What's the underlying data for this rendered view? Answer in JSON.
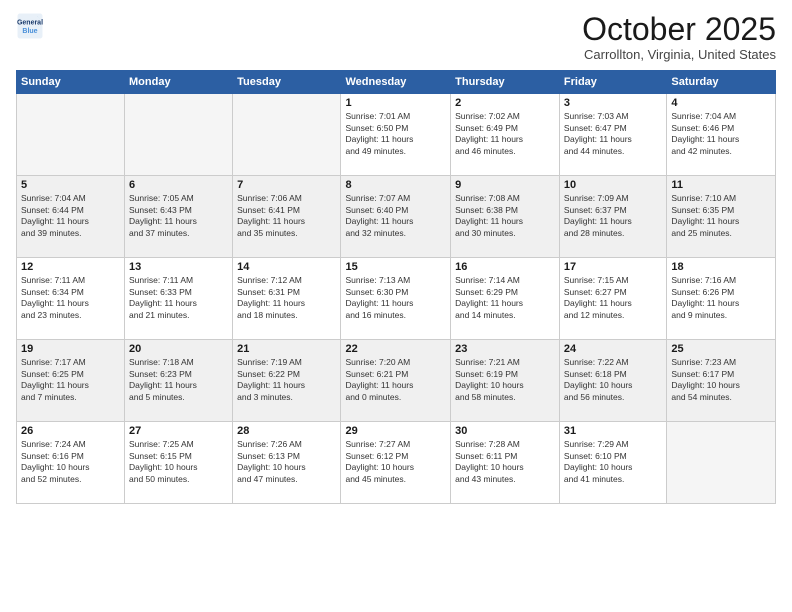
{
  "logo": {
    "line1": "General",
    "line2": "Blue"
  },
  "header": {
    "month": "October 2025",
    "location": "Carrollton, Virginia, United States"
  },
  "days_of_week": [
    "Sunday",
    "Monday",
    "Tuesday",
    "Wednesday",
    "Thursday",
    "Friday",
    "Saturday"
  ],
  "weeks": [
    {
      "bg": "white",
      "days": [
        {
          "num": "",
          "info": ""
        },
        {
          "num": "",
          "info": ""
        },
        {
          "num": "",
          "info": ""
        },
        {
          "num": "1",
          "info": "Sunrise: 7:01 AM\nSunset: 6:50 PM\nDaylight: 11 hours\nand 49 minutes."
        },
        {
          "num": "2",
          "info": "Sunrise: 7:02 AM\nSunset: 6:49 PM\nDaylight: 11 hours\nand 46 minutes."
        },
        {
          "num": "3",
          "info": "Sunrise: 7:03 AM\nSunset: 6:47 PM\nDaylight: 11 hours\nand 44 minutes."
        },
        {
          "num": "4",
          "info": "Sunrise: 7:04 AM\nSunset: 6:46 PM\nDaylight: 11 hours\nand 42 minutes."
        }
      ]
    },
    {
      "bg": "gray",
      "days": [
        {
          "num": "5",
          "info": "Sunrise: 7:04 AM\nSunset: 6:44 PM\nDaylight: 11 hours\nand 39 minutes."
        },
        {
          "num": "6",
          "info": "Sunrise: 7:05 AM\nSunset: 6:43 PM\nDaylight: 11 hours\nand 37 minutes."
        },
        {
          "num": "7",
          "info": "Sunrise: 7:06 AM\nSunset: 6:41 PM\nDaylight: 11 hours\nand 35 minutes."
        },
        {
          "num": "8",
          "info": "Sunrise: 7:07 AM\nSunset: 6:40 PM\nDaylight: 11 hours\nand 32 minutes."
        },
        {
          "num": "9",
          "info": "Sunrise: 7:08 AM\nSunset: 6:38 PM\nDaylight: 11 hours\nand 30 minutes."
        },
        {
          "num": "10",
          "info": "Sunrise: 7:09 AM\nSunset: 6:37 PM\nDaylight: 11 hours\nand 28 minutes."
        },
        {
          "num": "11",
          "info": "Sunrise: 7:10 AM\nSunset: 6:35 PM\nDaylight: 11 hours\nand 25 minutes."
        }
      ]
    },
    {
      "bg": "white",
      "days": [
        {
          "num": "12",
          "info": "Sunrise: 7:11 AM\nSunset: 6:34 PM\nDaylight: 11 hours\nand 23 minutes."
        },
        {
          "num": "13",
          "info": "Sunrise: 7:11 AM\nSunset: 6:33 PM\nDaylight: 11 hours\nand 21 minutes."
        },
        {
          "num": "14",
          "info": "Sunrise: 7:12 AM\nSunset: 6:31 PM\nDaylight: 11 hours\nand 18 minutes."
        },
        {
          "num": "15",
          "info": "Sunrise: 7:13 AM\nSunset: 6:30 PM\nDaylight: 11 hours\nand 16 minutes."
        },
        {
          "num": "16",
          "info": "Sunrise: 7:14 AM\nSunset: 6:29 PM\nDaylight: 11 hours\nand 14 minutes."
        },
        {
          "num": "17",
          "info": "Sunrise: 7:15 AM\nSunset: 6:27 PM\nDaylight: 11 hours\nand 12 minutes."
        },
        {
          "num": "18",
          "info": "Sunrise: 7:16 AM\nSunset: 6:26 PM\nDaylight: 11 hours\nand 9 minutes."
        }
      ]
    },
    {
      "bg": "gray",
      "days": [
        {
          "num": "19",
          "info": "Sunrise: 7:17 AM\nSunset: 6:25 PM\nDaylight: 11 hours\nand 7 minutes."
        },
        {
          "num": "20",
          "info": "Sunrise: 7:18 AM\nSunset: 6:23 PM\nDaylight: 11 hours\nand 5 minutes."
        },
        {
          "num": "21",
          "info": "Sunrise: 7:19 AM\nSunset: 6:22 PM\nDaylight: 11 hours\nand 3 minutes."
        },
        {
          "num": "22",
          "info": "Sunrise: 7:20 AM\nSunset: 6:21 PM\nDaylight: 11 hours\nand 0 minutes."
        },
        {
          "num": "23",
          "info": "Sunrise: 7:21 AM\nSunset: 6:19 PM\nDaylight: 10 hours\nand 58 minutes."
        },
        {
          "num": "24",
          "info": "Sunrise: 7:22 AM\nSunset: 6:18 PM\nDaylight: 10 hours\nand 56 minutes."
        },
        {
          "num": "25",
          "info": "Sunrise: 7:23 AM\nSunset: 6:17 PM\nDaylight: 10 hours\nand 54 minutes."
        }
      ]
    },
    {
      "bg": "white",
      "days": [
        {
          "num": "26",
          "info": "Sunrise: 7:24 AM\nSunset: 6:16 PM\nDaylight: 10 hours\nand 52 minutes."
        },
        {
          "num": "27",
          "info": "Sunrise: 7:25 AM\nSunset: 6:15 PM\nDaylight: 10 hours\nand 50 minutes."
        },
        {
          "num": "28",
          "info": "Sunrise: 7:26 AM\nSunset: 6:13 PM\nDaylight: 10 hours\nand 47 minutes."
        },
        {
          "num": "29",
          "info": "Sunrise: 7:27 AM\nSunset: 6:12 PM\nDaylight: 10 hours\nand 45 minutes."
        },
        {
          "num": "30",
          "info": "Sunrise: 7:28 AM\nSunset: 6:11 PM\nDaylight: 10 hours\nand 43 minutes."
        },
        {
          "num": "31",
          "info": "Sunrise: 7:29 AM\nSunset: 6:10 PM\nDaylight: 10 hours\nand 41 minutes."
        },
        {
          "num": "",
          "info": ""
        }
      ]
    }
  ]
}
